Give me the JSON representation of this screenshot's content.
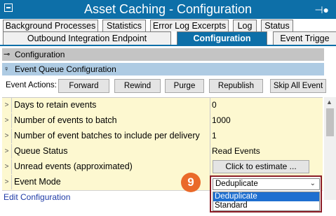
{
  "window": {
    "title": "Asset Caching - Configuration",
    "pin_icon": "pin-icon"
  },
  "tabs_row1": [
    "Background Processes",
    "Statistics",
    "Error Log Excerpts",
    "Log",
    "Status"
  ],
  "tabs_row2": [
    "Outbound Integration Endpoint",
    "Configuration",
    "Event Trigge"
  ],
  "active_tab": "Configuration",
  "sections": {
    "configuration": "Configuration",
    "event_queue": "Event Queue Configuration"
  },
  "event_actions": {
    "label": "Event Actions:",
    "buttons": [
      "Forward",
      "Rewind",
      "Purge",
      "Republish",
      "Skip All Event"
    ]
  },
  "rows": [
    {
      "name": "Days to retain events",
      "value": "0"
    },
    {
      "name": "Number of events to batch",
      "value": "1000"
    },
    {
      "name": "Number of event batches to include per delivery",
      "value": "1"
    },
    {
      "name": "Queue Status",
      "value": "Read Events"
    },
    {
      "name": "Unread events (approximated)",
      "button": "Click to estimate ..."
    },
    {
      "name": "Event Mode",
      "value": "Deduplicate"
    }
  ],
  "event_mode_dropdown": {
    "selected": "Deduplicate",
    "options": [
      "Deduplicate",
      "Standard"
    ]
  },
  "callout_number": "9",
  "edit_link": "Edit Configuration",
  "colors": {
    "accent": "#0d6fa8",
    "row_bg": "#fdf8d0",
    "callout": "#ea6a2a",
    "frame": "#8c1d27"
  }
}
